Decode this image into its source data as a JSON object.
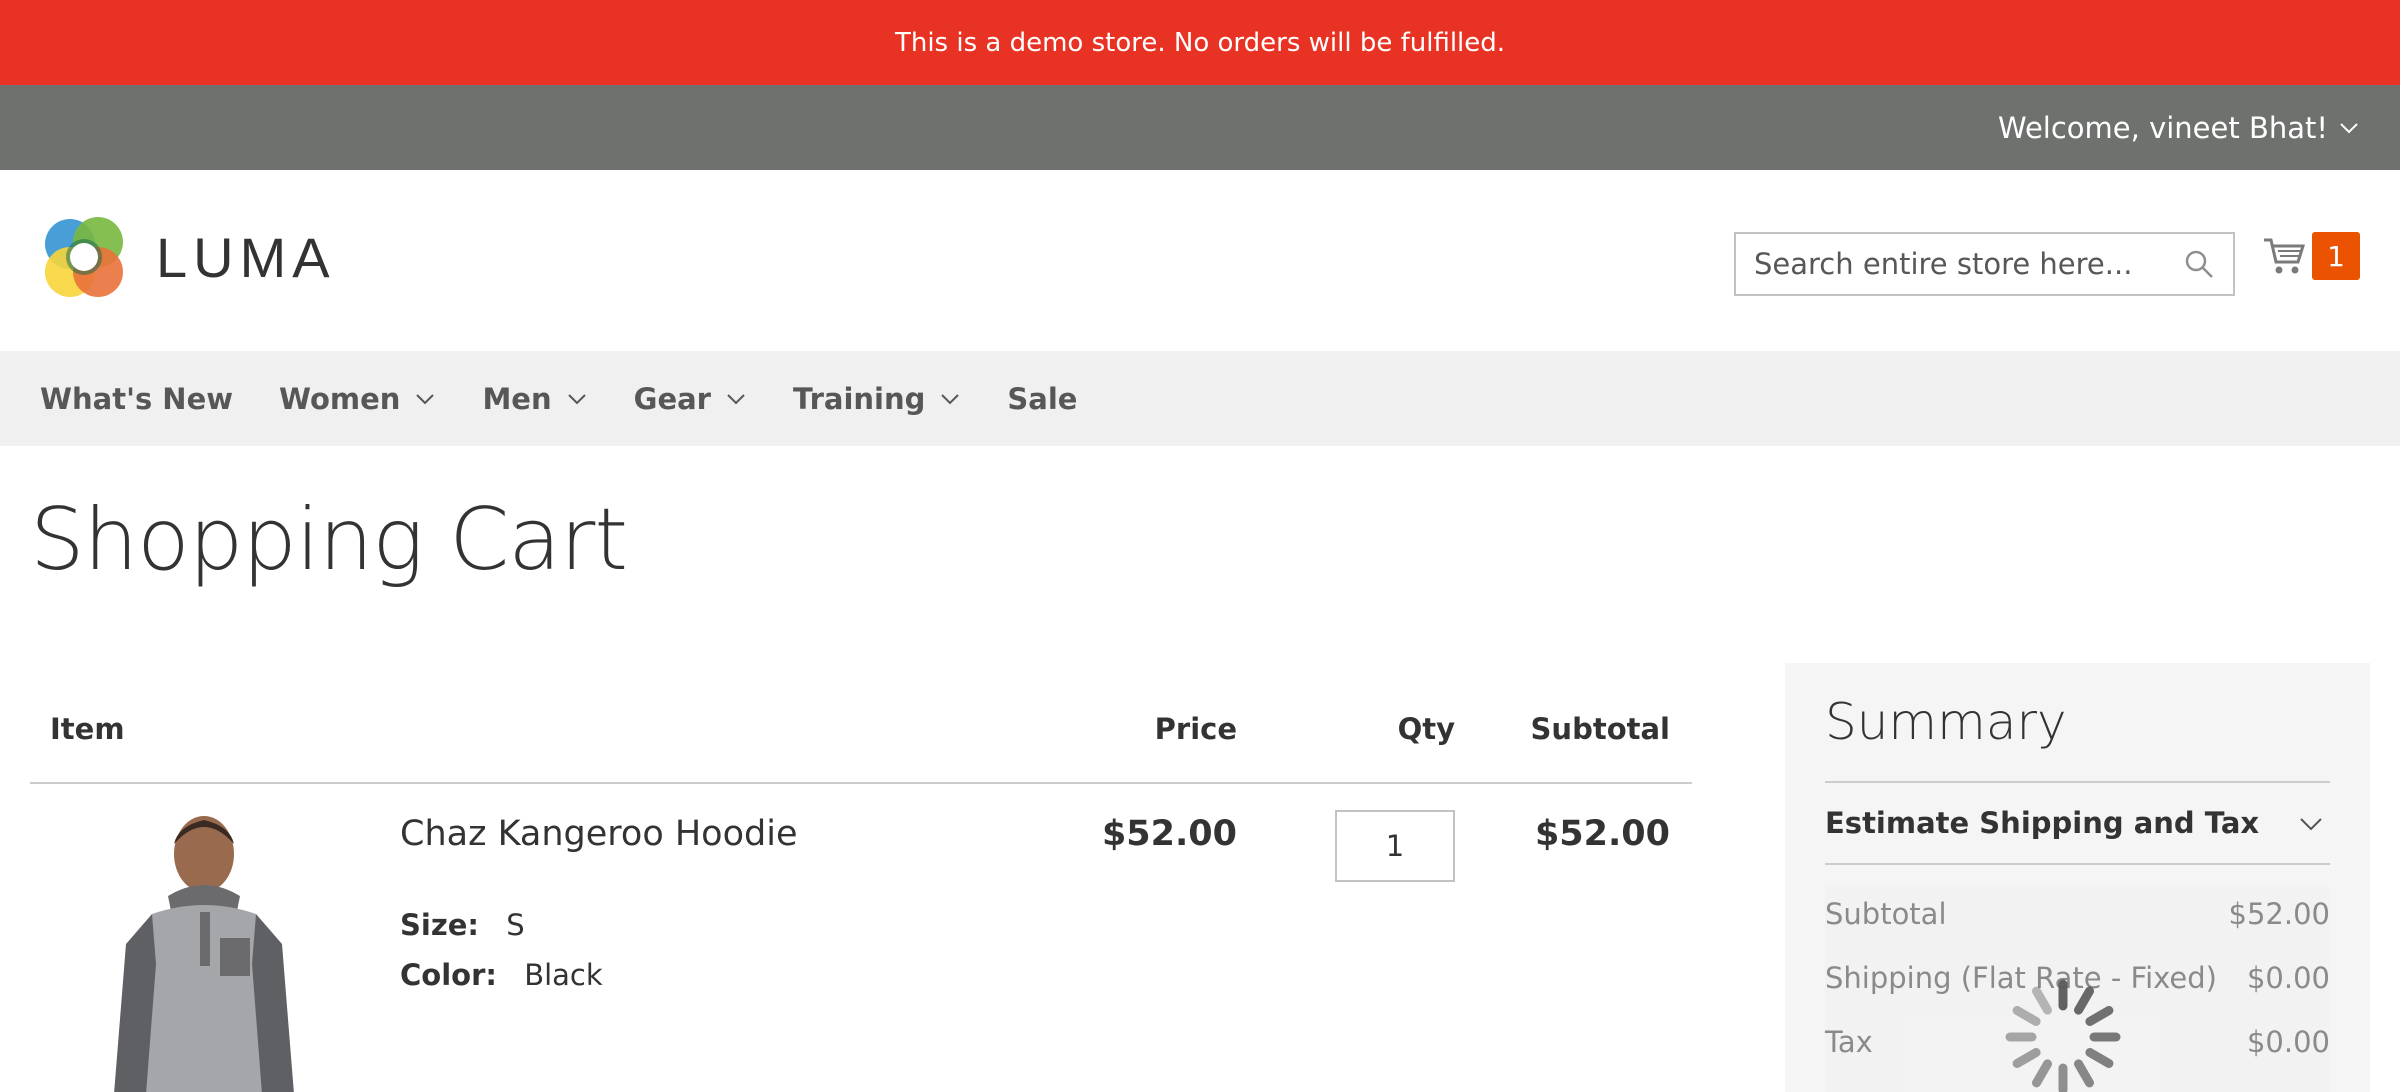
{
  "banner": {
    "text": "This is a demo store. No orders will be fulfilled."
  },
  "account": {
    "welcome": "Welcome, vineet Bhat!"
  },
  "header": {
    "logo_text": "LUMA",
    "search_placeholder": "Search entire store here...",
    "cart_count": "1"
  },
  "nav": {
    "items": [
      {
        "label": "What's New",
        "dropdown": false
      },
      {
        "label": "Women",
        "dropdown": true
      },
      {
        "label": "Men",
        "dropdown": true
      },
      {
        "label": "Gear",
        "dropdown": true
      },
      {
        "label": "Training",
        "dropdown": true
      },
      {
        "label": "Sale",
        "dropdown": false
      }
    ]
  },
  "page": {
    "title": "Shopping Cart"
  },
  "cart": {
    "columns": {
      "item": "Item",
      "price": "Price",
      "qty": "Qty",
      "subtotal": "Subtotal"
    },
    "items": [
      {
        "name": "Chaz Kangeroo Hoodie",
        "size_label": "Size:",
        "size": "S",
        "color_label": "Color:",
        "color": "Black",
        "price": "$52.00",
        "qty": "1",
        "subtotal": "$52.00"
      }
    ]
  },
  "summary": {
    "title": "Summary",
    "estimate_label": "Estimate Shipping and Tax",
    "rows": [
      {
        "label": "Subtotal",
        "value": "$52.00"
      },
      {
        "label": "Shipping (Flat Rate - Fixed)",
        "value": "$0.00"
      },
      {
        "label": "Tax",
        "value": "$0.00"
      }
    ]
  },
  "colors": {
    "banner": "#e83324",
    "topbar": "#6e716e",
    "nav_bg": "#f0f0f0",
    "cart_badge": "#eb5202",
    "summary_bg": "#f5f5f5"
  },
  "icons": [
    "chevron-down-icon",
    "search-icon",
    "cart-icon",
    "luma-logo",
    "loading-spinner-icon"
  ]
}
